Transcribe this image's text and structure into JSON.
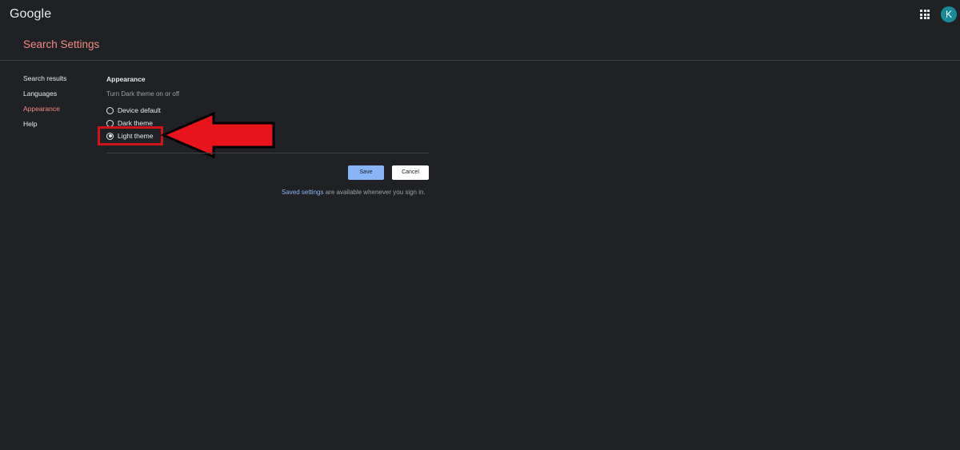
{
  "header": {
    "logo_text": "Google",
    "avatar_letter": "K",
    "accent_color": "#f28b82",
    "avatar_color": "#1a8a96"
  },
  "page": {
    "title": "Search Settings"
  },
  "sidebar": {
    "items": [
      {
        "label": "Search results",
        "active": false
      },
      {
        "label": "Languages",
        "active": false
      },
      {
        "label": "Appearance",
        "active": true
      },
      {
        "label": "Help",
        "active": false
      }
    ]
  },
  "appearance": {
    "title": "Appearance",
    "subtitle": "Turn Dark theme on or off",
    "options": [
      {
        "label": "Device default",
        "checked": false
      },
      {
        "label": "Dark theme",
        "checked": false
      },
      {
        "label": "Light theme",
        "checked": true
      }
    ]
  },
  "actions": {
    "save_label": "Save",
    "cancel_label": "Cancel"
  },
  "footnote": {
    "link_text": "Saved settings",
    "text": " are available whenever you sign in."
  },
  "annotation": {
    "highlight_color": "#d0131b",
    "arrow_color": "#e8141c",
    "arrow_icon": "left-arrow-icon"
  }
}
